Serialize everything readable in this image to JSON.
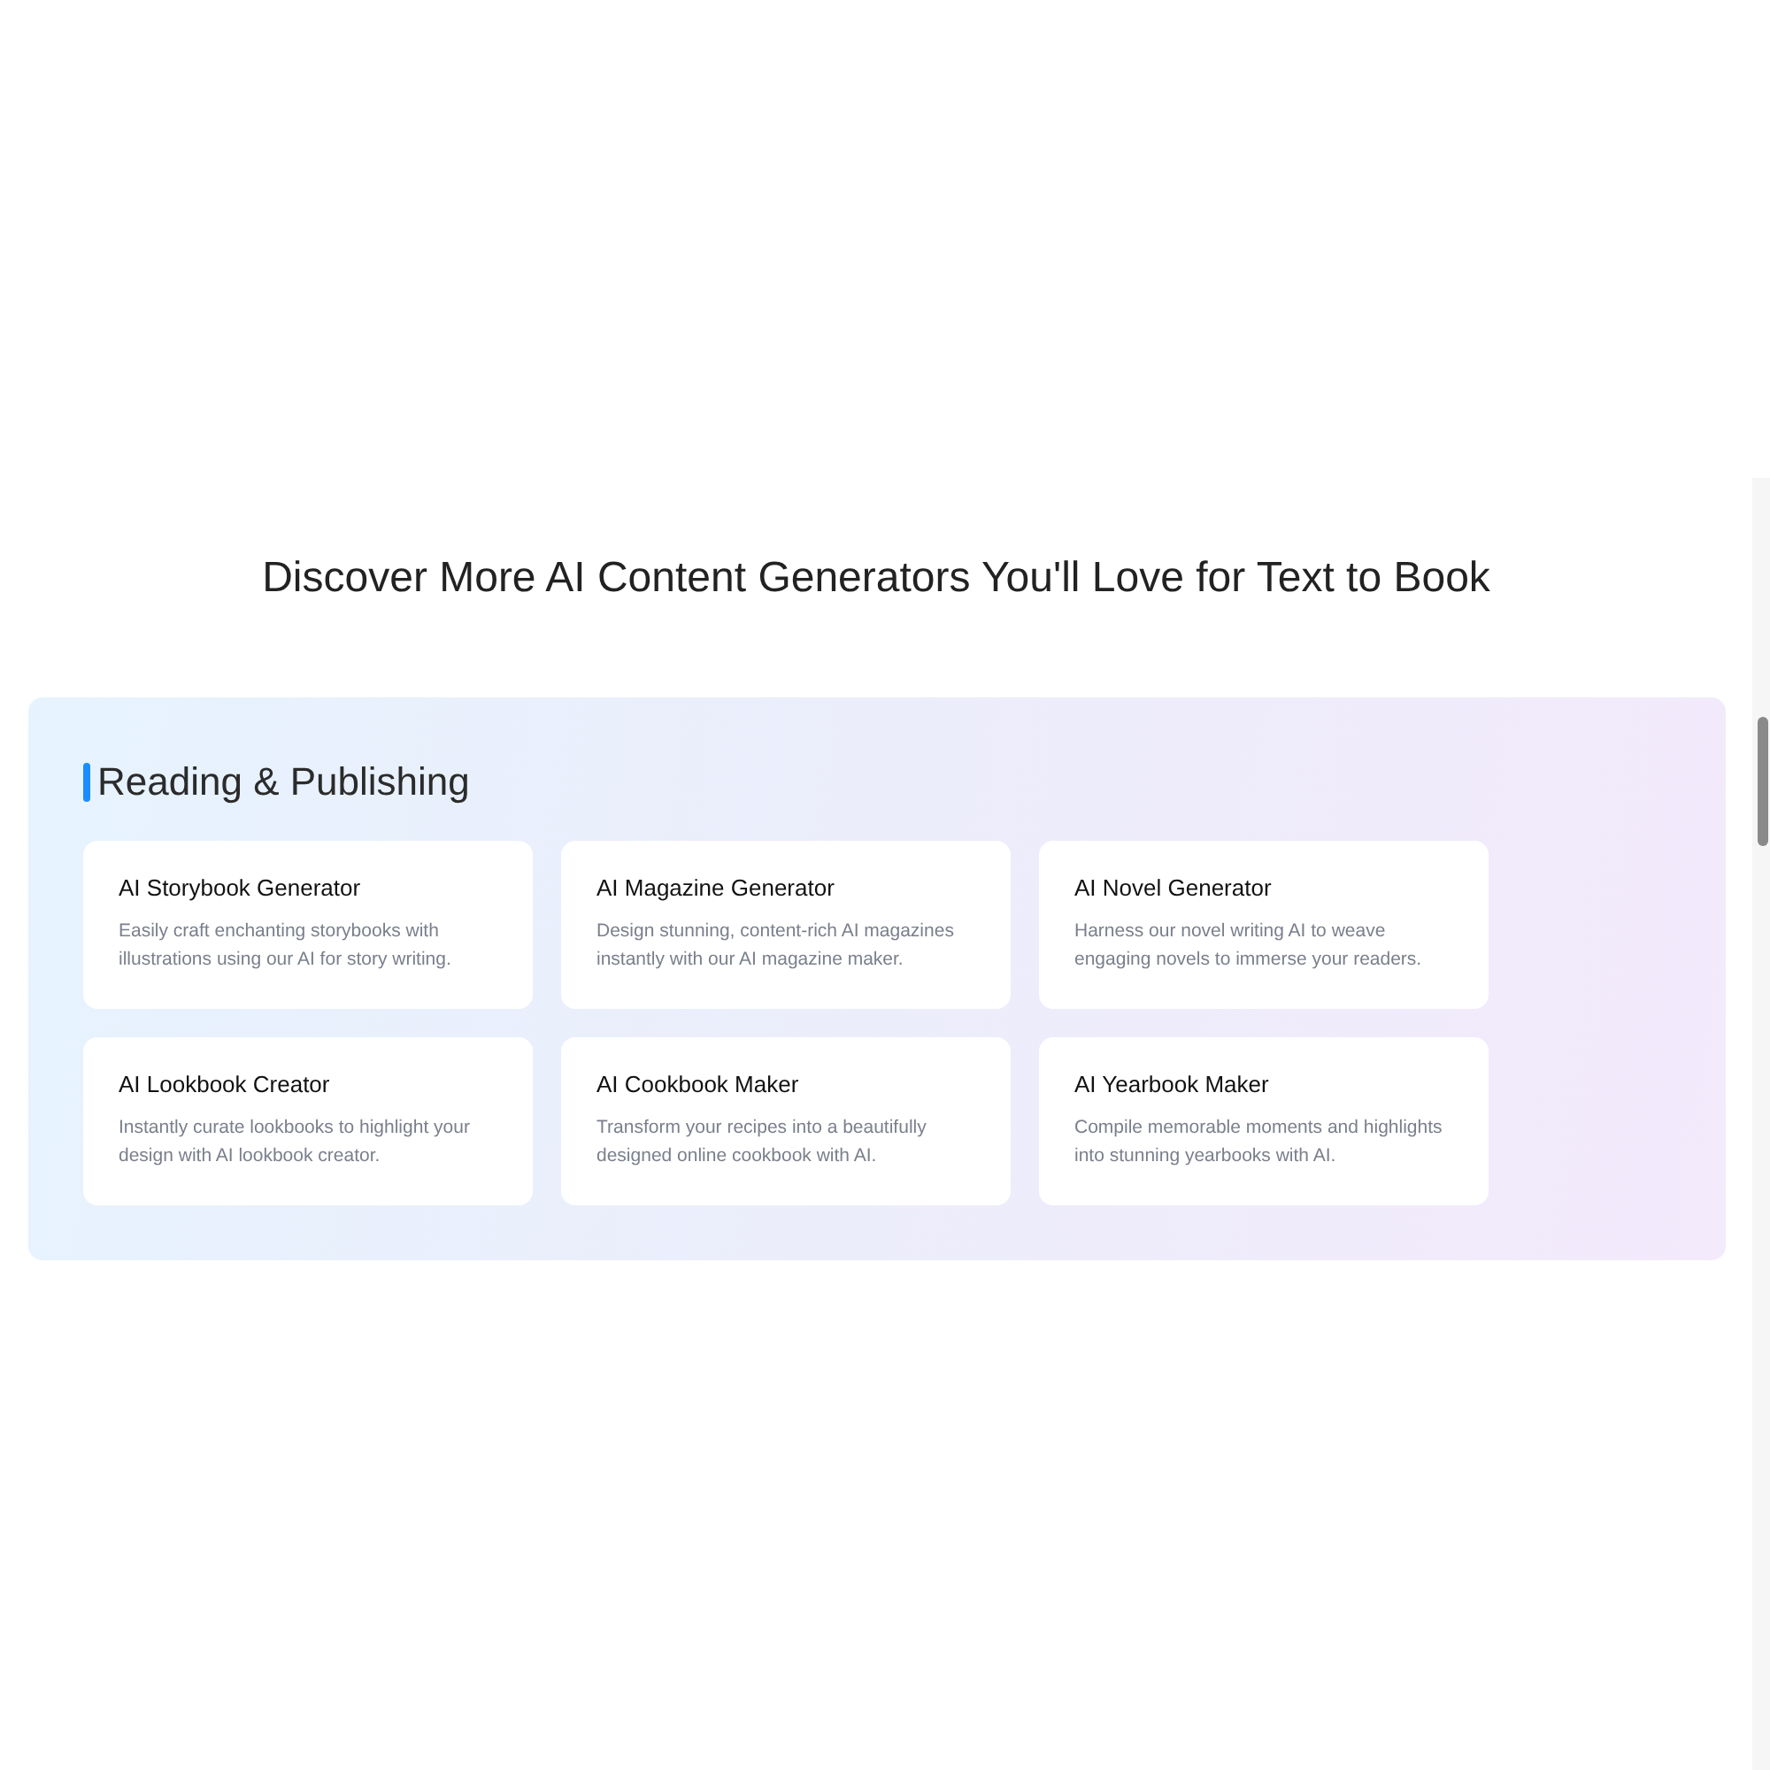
{
  "heading": "Discover More AI Content Generators You'll Love for Text to Book",
  "section": {
    "title": "Reading & Publishing",
    "cards": [
      {
        "title": "AI Storybook Generator",
        "description": "Easily craft enchanting storybooks with illustrations using our AI for story writing."
      },
      {
        "title": "AI Magazine Generator",
        "description": "Design stunning, content-rich AI magazines instantly with our AI magazine maker."
      },
      {
        "title": "AI Novel Generator",
        "description": "Harness our novel writing AI to weave engaging novels to immerse your readers."
      },
      {
        "title": "AI Lookbook Creator",
        "description": "Instantly curate lookbooks to highlight your design with AI lookbook creator."
      },
      {
        "title": "AI Cookbook Maker",
        "description": "Transform your recipes into a beautifully designed online cookbook with AI."
      },
      {
        "title": "AI Yearbook Maker",
        "description": "Compile memorable moments and highlights into stunning yearbooks with AI."
      }
    ]
  }
}
